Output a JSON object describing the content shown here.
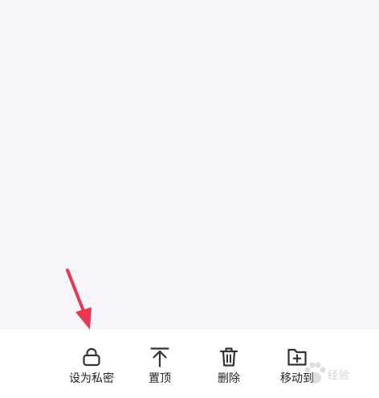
{
  "bottom_actions": [
    {
      "label": "设为私密",
      "icon": "lock-icon"
    },
    {
      "label": "置顶",
      "icon": "pin-top-icon"
    },
    {
      "label": "删除",
      "icon": "trash-icon"
    },
    {
      "label": "移动到",
      "icon": "folder-plus-icon"
    }
  ],
  "watermark": {
    "text": "经验"
  },
  "colors": {
    "background": "#f7f5f9",
    "bar_background": "#ffffff",
    "icon": "#333333",
    "label": "#222222",
    "annotation_arrow": "#e8384f"
  }
}
